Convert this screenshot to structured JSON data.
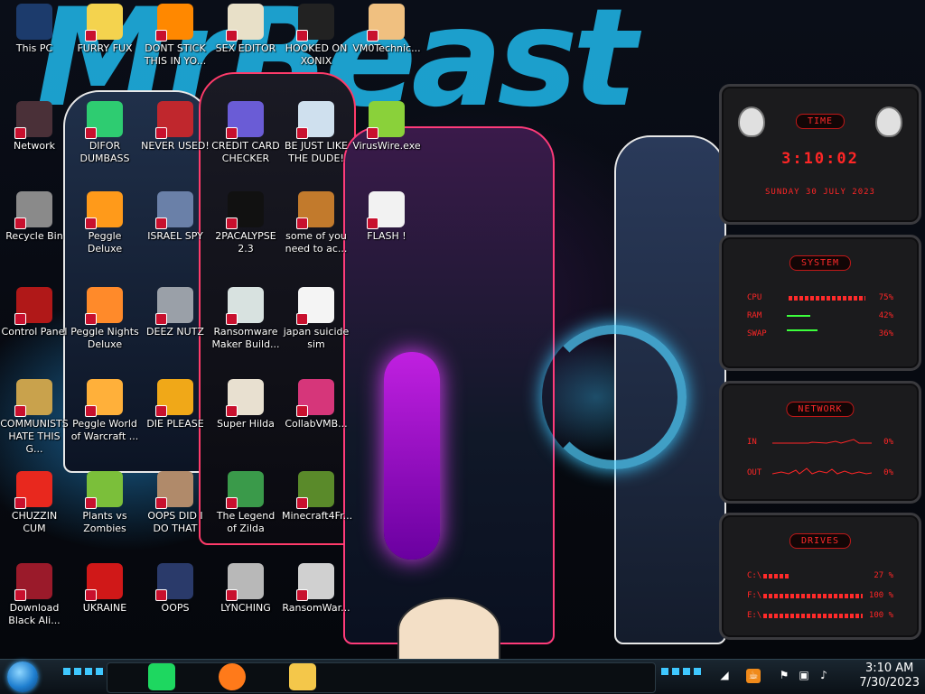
{
  "wallpaper": {
    "title": "MrBeast"
  },
  "desktop": {
    "icons": [
      {
        "label": "This PC",
        "icon": "computer-icon",
        "color": "#1c3b6c"
      },
      {
        "label": "FURRY FUX",
        "icon": "cartoon-icon",
        "color": "#f4d34e"
      },
      {
        "label": "DONT STICK THIS IN YO...",
        "icon": "vlc-cone-icon",
        "color": "#ff8800"
      },
      {
        "label": "SEX EDITOR",
        "icon": "hxd-icon",
        "color": "#e8e0c8"
      },
      {
        "label": "HOOKED ON XONIX",
        "icon": "xonix-icon",
        "color": "#222"
      },
      {
        "label": "VM0Technic...",
        "icon": "doctor-icon",
        "color": "#f0c080"
      },
      {
        "label": "Network",
        "icon": "network-icon",
        "color": "#4a3038"
      },
      {
        "label": "DIFOR DUMBASS",
        "icon": "spotify-like-icon",
        "color": "#2ecc71"
      },
      {
        "label": "NEVER USED!",
        "icon": "dev-cpp-icon",
        "color": "#c0272d"
      },
      {
        "label": "CREDIT CARD CHECKER",
        "icon": "card-icon",
        "color": "#6a5cd6"
      },
      {
        "label": "BE JUST LIKE THE DUDE!",
        "icon": "santa-icon",
        "color": "#cfe0ee"
      },
      {
        "label": "VirusWire.exe",
        "icon": "lime-icon",
        "color": "#8ad13a"
      },
      {
        "label": "Recycle Bin",
        "icon": "recycle-bin-icon",
        "color": "#8a8a8a"
      },
      {
        "label": "Peggle Deluxe",
        "icon": "peggle-icon",
        "color": "#ff9a1a"
      },
      {
        "label": "ISRAEL SPY",
        "icon": "network-folder-icon",
        "color": "#6a80a8"
      },
      {
        "label": "2PACALYPSE 2.3",
        "icon": "terminal-icon",
        "color": "#111"
      },
      {
        "label": "some of you need to ac...",
        "icon": "beaver-icon",
        "color": "#c27a2c"
      },
      {
        "label": "FLASH !",
        "icon": "document-icon",
        "color": "#f2f2f2"
      },
      {
        "label": "Control Panel",
        "icon": "control-panel-icon",
        "color": "#b01818"
      },
      {
        "label": "Peggle Nights Deluxe",
        "icon": "peggle-icon",
        "color": "#ff8a2a"
      },
      {
        "label": "DEEZ NUTZ",
        "icon": "windows-stack-icon",
        "color": "#9aa0a8"
      },
      {
        "label": "Ransomware Maker Build...",
        "icon": "app-window-icon",
        "color": "#d8e2e0"
      },
      {
        "label": "japan suicide sim",
        "icon": "file-icon",
        "color": "#f4f4f4"
      },
      {
        "label": "COMMUNISTS HATE THIS G...",
        "icon": "money-bag-icon",
        "color": "#c9a24c"
      },
      {
        "label": "Peggle World of Warcraft ...",
        "icon": "peggle-icon",
        "color": "#ffb03a"
      },
      {
        "label": "DIE PLEASE",
        "icon": "de-icon",
        "color": "#f0a818"
      },
      {
        "label": "Super Hilda",
        "icon": "pixel-dog-icon",
        "color": "#e8e0d0"
      },
      {
        "label": "CollabVMB...",
        "icon": "monitor-icon",
        "color": "#d6367a"
      },
      {
        "label": "CHUZZIN CUM",
        "icon": "chuzzle-icon",
        "color": "#e8281e"
      },
      {
        "label": "Plants vs Zombies",
        "icon": "plant-icon",
        "color": "#7bbf3a"
      },
      {
        "label": "OOPS DID I DO THAT",
        "icon": "portrait-icon",
        "color": "#b08a6a"
      },
      {
        "label": "The Legend of Zilda",
        "icon": "pixel-hero-icon",
        "color": "#3a9a4a"
      },
      {
        "label": "Minecraft4Fr...",
        "icon": "grass-block-icon",
        "color": "#5a8a2a"
      },
      {
        "label": "Download Black Ali...",
        "icon": "red-orb-icon",
        "color": "#9a1a2a"
      },
      {
        "label": "UKRAINE",
        "icon": "radiation-icon",
        "color": "#d01818"
      },
      {
        "label": "OOPS",
        "icon": "shield-monitor-icon",
        "color": "#2a3a6a"
      },
      {
        "label": "LYNCHING",
        "icon": "ring-icon",
        "color": "#b8b8b8"
      },
      {
        "label": "RansomWar...",
        "icon": "skull-icon",
        "color": "#d0d0d0"
      }
    ]
  },
  "gadget": {
    "time": {
      "tag": "TIME",
      "clock": "3:10:02",
      "date": "SUNDAY 30 JULY 2023"
    },
    "system": {
      "tag": "SYSTEM",
      "cpu_label": "CPU",
      "cpu_value": "75%",
      "ram_label": "RAM",
      "ram_value": "42%",
      "swap_label": "SWAP",
      "swap_value": "36%",
      "cpu": 0.75
    },
    "network": {
      "tag": "NETWORK",
      "in_label": "IN",
      "in_value": "0%",
      "out_label": "OUT",
      "out_value": "0%"
    },
    "drives": {
      "tag": "DRIVES",
      "c_label": "C:\\",
      "c_value": "27 %",
      "f_label": "F:\\",
      "f_value": "100 %",
      "e_label": "E:\\",
      "e_value": "100 %",
      "c": 0.27,
      "f": 1.0,
      "e": 1.0
    }
  },
  "taskbar": {
    "apps": [
      {
        "name": "spotify-icon",
        "color": "#1ed760"
      },
      {
        "name": "firefox-icon",
        "color": "#ff7a1a"
      },
      {
        "name": "file-explorer-icon",
        "color": "#f4c74a"
      }
    ],
    "tray_icons": [
      "show-hidden-icons-icon",
      "java-icon",
      "security-flag-icon",
      "network-status-icon",
      "volume-icon"
    ],
    "time": "3:10 AM",
    "date": "7/30/2023"
  }
}
